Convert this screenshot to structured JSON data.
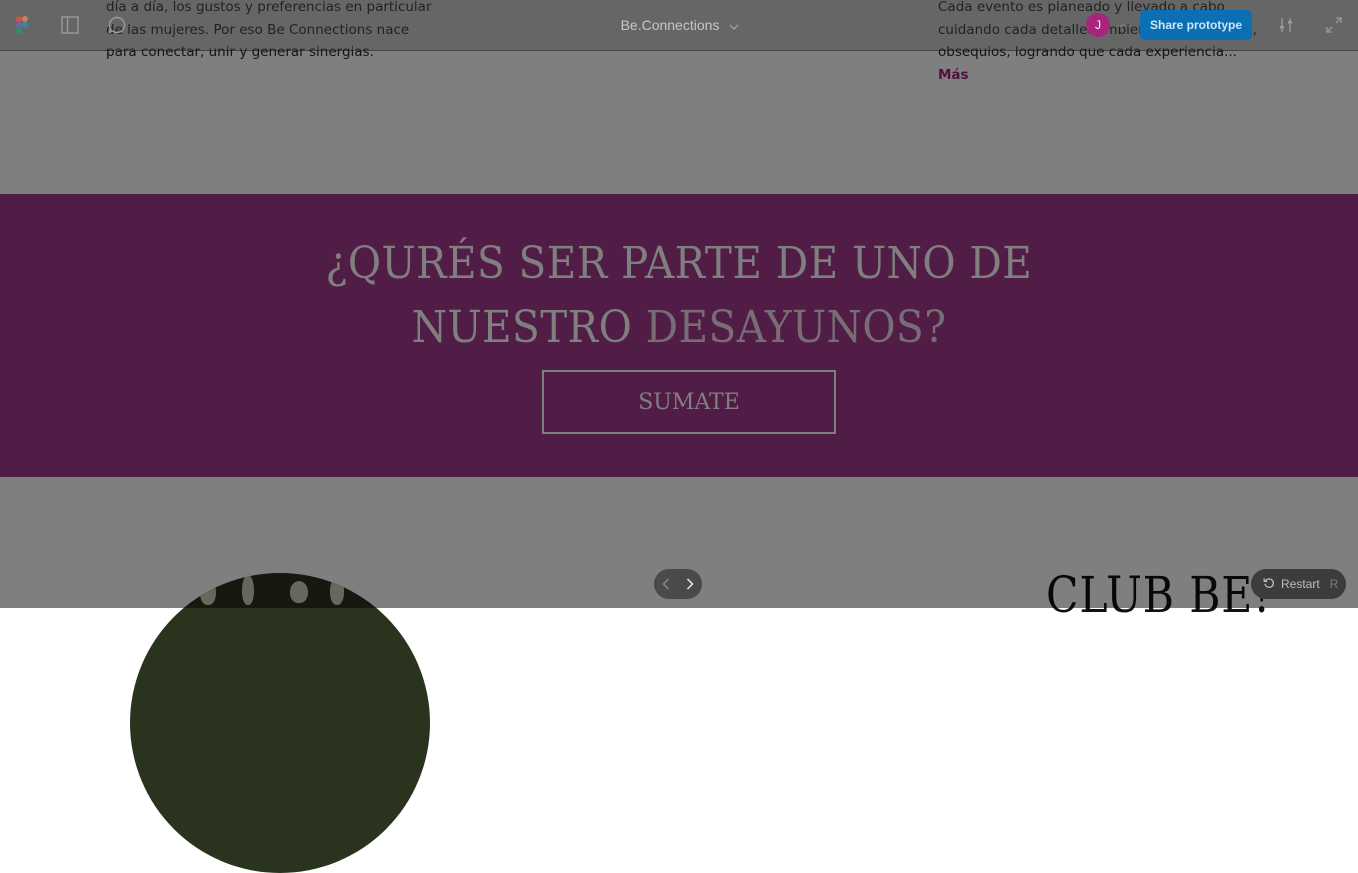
{
  "toolbar": {
    "file_title": "Be.Connections",
    "avatar_initial": "J",
    "share_label": "Share prototype",
    "icons": [
      "figma-logo-icon",
      "sidebar-toggle-icon",
      "comment-icon",
      "chevron-down-icon",
      "settings-sliders-icon",
      "fullscreen-icon"
    ]
  },
  "content": {
    "left_paragraph": "día a día, los gustos y preferencias en particular de las mujeres. Por eso Be Connections nace para conectar, unir y generar sinergias.",
    "right_paragraph": "Cada evento es planeado y llevado a cabo cuidando cada detalle: ambientación, catering, obsequios, logrando que cada experiencia...",
    "more_link": "Más",
    "cta_line1": "¿QURÉS SER PARTE DE UNO DE",
    "cta_line2_a": "NUESTRO ",
    "cta_line2_b": "DESAYUNOS?",
    "cta_button": "SUMATE",
    "club_title": "CLUB BE!"
  },
  "controls": {
    "restart_label": "Restart",
    "restart_shortcut": "R"
  },
  "colors": {
    "brand_purple": "#a23a8e",
    "link_magenta": "#a0237e",
    "share_blue": "#0b6fb4",
    "avatar": "#a8247d"
  }
}
